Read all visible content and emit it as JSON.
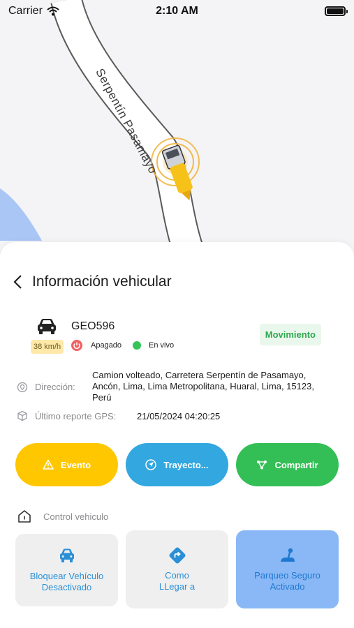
{
  "status_bar": {
    "carrier": "Carrier",
    "time": "2:10 AM"
  },
  "map": {
    "road_name": "Serpentín Pasamayo"
  },
  "sheet": {
    "title": "Información vehicular",
    "vehicle": {
      "plate": "GEO596",
      "speed": "38 km/h",
      "status": "Movimiento",
      "engine": "Apagado",
      "connection": "En vivo"
    },
    "address": {
      "label": "Dirección:",
      "value": "Camion volteado, Carretera Serpentín de Pasamayo, Ancón, Lima, Lima Metropolitana, Huaral, Lima, 15123, Perú"
    },
    "gps": {
      "label": "Último reporte GPS:",
      "value": "21/05/2024 04:20:25"
    },
    "actions": [
      {
        "label": "Evento",
        "icon": "warning-icon",
        "color": "#ffc700"
      },
      {
        "label": "Trayecto...",
        "icon": "navigation-icon",
        "color": "#33a7e0"
      },
      {
        "label": "Compartir",
        "icon": "share-icon",
        "color": "#33bf55"
      }
    ],
    "control": {
      "label": "Control vehiculo",
      "tiles": [
        {
          "label_1": "Bloquear Vehículo",
          "label_2": "Desactivado",
          "icon": "car-lock-icon"
        },
        {
          "label_1": "Como",
          "label_2": "LLegar a",
          "icon": "directions-icon"
        },
        {
          "label_1": "Parqueo Seguro",
          "label_2": "Activado",
          "icon": "parking-lever-icon"
        }
      ]
    }
  }
}
